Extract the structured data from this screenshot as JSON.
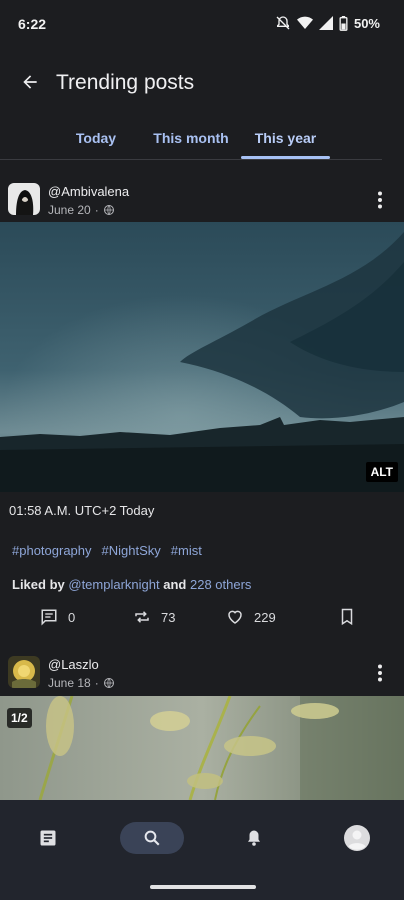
{
  "status": {
    "time": "6:22",
    "battery": "50%"
  },
  "header": {
    "title": "Trending posts"
  },
  "tabs": [
    {
      "label": "Today"
    },
    {
      "label": "This month"
    },
    {
      "label": "This year"
    }
  ],
  "active_tab": "This year",
  "posts": [
    {
      "username": "@Ambivalena",
      "date": "June 20",
      "separator": "·",
      "alt_badge": "ALT",
      "caption": "01:58 A.M. UTC+2 Today",
      "hashtags": [
        "#photography",
        "#NightSky",
        "#mist"
      ],
      "likes": {
        "prefix": "Liked by",
        "user": "@templarknight",
        "conj": "and",
        "others": "228 others"
      },
      "replies": "0",
      "boosts": "73",
      "favourites": "229"
    },
    {
      "username": "@Laszlo",
      "date": "June 18",
      "separator": "·",
      "page_indicator": "1/2"
    }
  ],
  "nav": [
    "feed-icon",
    "search-icon",
    "bell-icon",
    "profile-icon"
  ],
  "colors": {
    "background": "#1c1d20",
    "accent": "#a7c1f4",
    "link": "#8ea6d8",
    "nav_background": "#22252d"
  }
}
